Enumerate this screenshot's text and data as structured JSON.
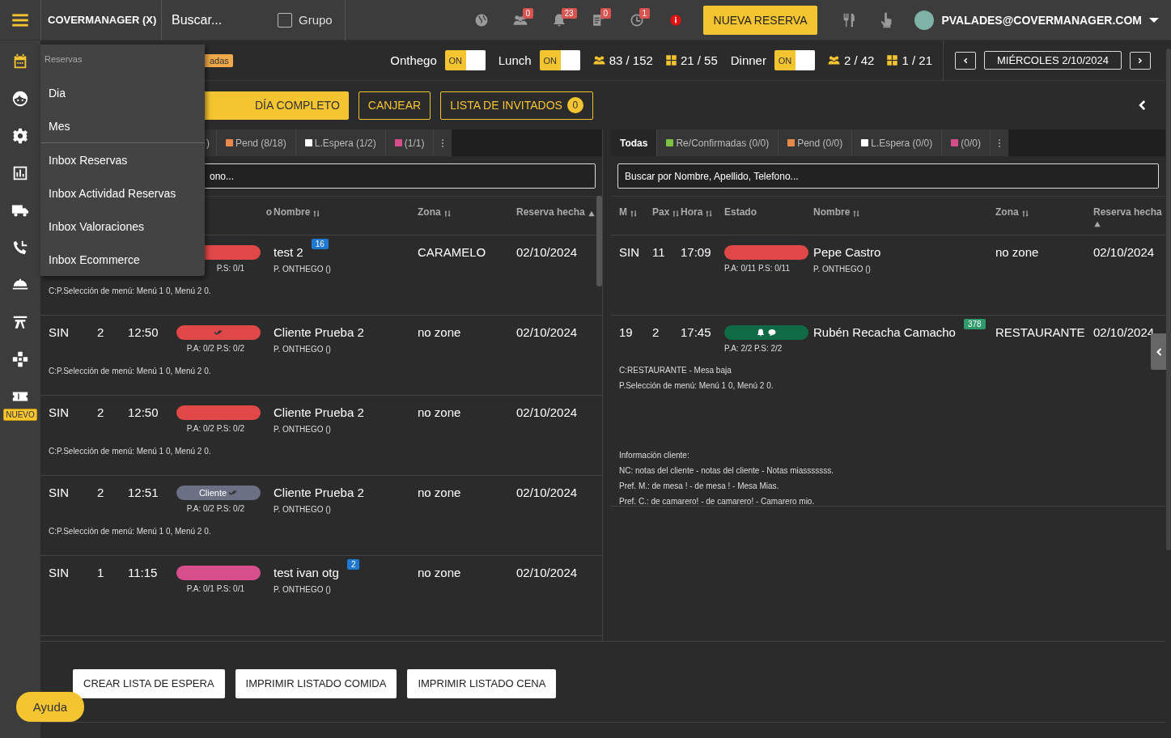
{
  "topbar": {
    "brand": "COVERMANAGER (X)",
    "search": {
      "placeholder": "Buscar..."
    },
    "group": {
      "label": "Grupo",
      "checked": false
    },
    "notifications": [
      {
        "kind": "globe"
      },
      {
        "kind": "people",
        "count": "0"
      },
      {
        "kind": "bell",
        "count": "23"
      },
      {
        "kind": "clipboard",
        "count": "0"
      },
      {
        "kind": "clock",
        "count": "1"
      },
      {
        "kind": "alert"
      }
    ],
    "new_button": "NUEVA RESERVA",
    "tools": [
      {
        "kind": "cutlery"
      },
      {
        "kind": "hand"
      }
    ],
    "user": "PVALADES@COVERMANAGER.COM"
  },
  "sidebar": {
    "items": [
      {
        "kind": "calendar",
        "selected": true
      },
      {
        "kind": "face",
        "selected": false
      },
      {
        "kind": "gear",
        "selected": false
      },
      {
        "kind": "chart",
        "selected": false
      },
      {
        "kind": "truck",
        "selected": false
      },
      {
        "kind": "phone",
        "selected": false
      },
      {
        "kind": "cloche",
        "selected": false
      },
      {
        "kind": "table",
        "selected": false
      },
      {
        "kind": "puzzle",
        "selected": false
      },
      {
        "kind": "ticket",
        "selected": false,
        "badge": "NUEVO"
      }
    ]
  },
  "menu": {
    "header": "Reservas",
    "groups": [
      [
        "Dia",
        "Mes"
      ],
      [
        "Inbox Reservas",
        "Inbox Actividad Reservas",
        "Inbox Valoraciones",
        "Inbox Ecommerce"
      ]
    ]
  },
  "services_bar": {
    "tag": "adas",
    "services": [
      {
        "name": "Onthego",
        "toggle": "ON",
        "on": true
      },
      {
        "name": "Lunch",
        "toggle": "ON",
        "on": true,
        "pax": "83 / 152",
        "tables": "21 / 55"
      },
      {
        "name": "Dinner",
        "toggle": "ON",
        "on": true,
        "pax": "2 / 42",
        "tables": "1 / 21"
      }
    ],
    "date": "MIÉRCOLES 2/10/2024"
  },
  "actions": [
    {
      "label": "DÍA COMPLETO",
      "kind": "filled"
    },
    {
      "label": "CANJEAR",
      "kind": "outline"
    },
    {
      "label": "LISTA DE INVITADOS",
      "kind": "outline",
      "count": "0"
    }
  ],
  "left_panel": {
    "tabs": [
      {
        "kind": "tab",
        "label": ")",
        "selected": false
      },
      {
        "kind": "tab",
        "label": "Pend (8/18)",
        "color": "#e8894a",
        "selected": false
      },
      {
        "kind": "tab",
        "label": "L.Espera (1/2)",
        "color": "#ffffff",
        "selected": false
      },
      {
        "kind": "tab",
        "label": "(1/1)",
        "color": "#d64f8c",
        "selected": false
      },
      {
        "kind": "more"
      }
    ],
    "search": {
      "placeholder": "ono..."
    },
    "columns": [
      {
        "label": "o"
      },
      {
        "label": "Nombre",
        "sortable": true
      },
      {
        "label": "Zona",
        "sortable": true
      },
      {
        "label": "Reserva hecha",
        "sorted_ascending": true
      }
    ],
    "rows": [
      {
        "status": {
          "color": "#e04848"
        },
        "sub": "P.S: 0/1",
        "name": "test 2",
        "badge": {
          "text": "16",
          "color": "#1f78d1"
        },
        "origin": "P. ONTHEGO ()",
        "zone": "CARAMELO",
        "date": "02/10/2024",
        "notes": [
          "C:P.Selección de menú: Menú 1 0, Menú 2 0."
        ]
      },
      {
        "m": "SIN",
        "pax": "2",
        "time": "12:50",
        "status": {
          "color": "#e04848",
          "icons": [
            {
              "kind": "checks"
            }
          ]
        },
        "sub": "P.A: 0/2 P.S: 0/2",
        "name": "Cliente Prueba 2",
        "origin": "P. ONTHEGO ()",
        "zone": "no zone",
        "date": "02/10/2024",
        "notes": [
          "C:P.Selección de menú: Menú 1 0, Menú 2 0."
        ]
      },
      {
        "m": "SIN",
        "pax": "2",
        "time": "12:50",
        "status": {
          "color": "#e04848"
        },
        "sub": "P.A: 0/2 P.S: 0/2",
        "name": "Cliente Prueba 2",
        "origin": "P. ONTHEGO ()",
        "zone": "no zone",
        "date": "02/10/2024",
        "notes": [
          "C:P.Selección de menú: Menú 1 0, Menú 2 0."
        ]
      },
      {
        "m": "SIN",
        "pax": "2",
        "time": "12:51",
        "status": {
          "color": "#6b7084",
          "label": "Cliente",
          "icons": [
            {
              "kind": "checks"
            }
          ]
        },
        "sub": "P.A: 0/2 P.S: 0/2",
        "name": "Cliente Prueba 2",
        "origin": "P. ONTHEGO ()",
        "zone": "no zone",
        "date": "02/10/2024",
        "notes": [
          "C:P.Selección de menú: Menú 1 0, Menú 2 0."
        ]
      },
      {
        "m": "SIN",
        "pax": "1",
        "time": "11:15",
        "status": {
          "color": "#d64f8c"
        },
        "sub": "P.A: 0/1 P.S: 0/1",
        "name": "test ivan otg",
        "badge": {
          "text": "2",
          "color": "#1f78d1"
        },
        "origin": "P. ONTHEGO ()",
        "zone": "no zone",
        "date": "02/10/2024",
        "notes": []
      }
    ]
  },
  "right_panel": {
    "tabs": [
      {
        "kind": "tab",
        "label": "Todas",
        "selected": true
      },
      {
        "kind": "tab",
        "label": "Re/Confirmadas (0/0)",
        "color": "#7cc142",
        "selected": false
      },
      {
        "kind": "tab",
        "label": "Pend (0/0)",
        "color": "#e8894a",
        "selected": false
      },
      {
        "kind": "tab",
        "label": "L.Espera (0/0)",
        "color": "#ffffff",
        "selected": false
      },
      {
        "kind": "tab",
        "label": "(0/0)",
        "color": "#d64f8c",
        "selected": false
      },
      {
        "kind": "more"
      }
    ],
    "search": {
      "placeholder": "Buscar por Nombre, Apellido, Telefono..."
    },
    "columns": [
      {
        "label": "M",
        "sortable": true
      },
      {
        "label": "Pax",
        "sortable": true
      },
      {
        "label": "Hora",
        "sortable": true
      },
      {
        "label": "Estado"
      },
      {
        "label": "Nombre",
        "sortable": true
      },
      {
        "label": "Zona",
        "sortable": true
      },
      {
        "label": "Reserva hecha",
        "sorted_ascending": true
      }
    ],
    "rows": [
      {
        "m": "SIN",
        "pax": "11",
        "time": "17:09",
        "status": {
          "color": "#e04848"
        },
        "sub": "P.A: 0/11 P.S: 0/11",
        "name": "Pepe Castro",
        "origin": "P. ONTHEGO ()",
        "zone": "no zone",
        "date": "02/10/2024",
        "notes": []
      },
      {
        "m": "19",
        "pax": "2",
        "time": "17:45",
        "status": {
          "color": "#0f6b46",
          "icons": [
            {
              "kind": "bell"
            },
            {
              "kind": "chat"
            }
          ]
        },
        "sub": "P.A: 2/2 P.S: 2/2",
        "name": "Rubén Recacha Camacho",
        "badge": {
          "text": "378",
          "color": "#2e9c6a"
        },
        "zone": "RESTAURANTE",
        "date": "02/10/2024",
        "notes": [
          "C:RESTAURANTE - Mesa baja",
          "P.Selección de menú: Menú 1 0, Menú 2 0."
        ],
        "client_info": [
          "Información cliente:",
          "NC: notas del cliente - notas del cliente - Notas miasssssss.",
          "Pref. M.: de mesa ! - de mesa ! - Mesa Mias.",
          "Pref. C.: de camarero! - de camarero! - Camarero mio."
        ]
      }
    ]
  },
  "footer_buttons": [
    "CREAR LISTA DE ESPERA",
    "IMPRIMIR LISTADO COMIDA",
    "IMPRIMIR LISTADO CENA"
  ],
  "help_button": "Ayuda"
}
